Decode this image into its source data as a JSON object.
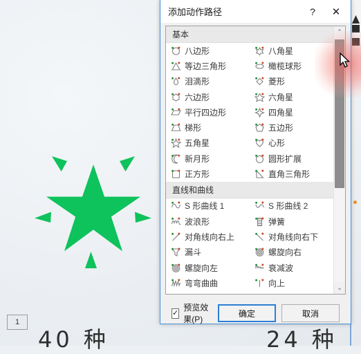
{
  "background": {
    "slide_number": "1",
    "label_left": "40 种",
    "label_right": "24 种",
    "star_color": "#0ec25c"
  },
  "dialog": {
    "title": "添加动作路径",
    "help_button": "?",
    "close_button": "✕",
    "accent_color": "#2a7fd4",
    "sections": [
      {
        "header": "基本",
        "items": [
          {
            "label": "八边形",
            "icon": "octagon-path-icon"
          },
          {
            "label": "八角星",
            "icon": "eight-point-star-path-icon"
          },
          {
            "label": "等边三角形",
            "icon": "equilateral-triangle-path-icon"
          },
          {
            "label": "橄榄球形",
            "icon": "football-path-icon"
          },
          {
            "label": "泪滴形",
            "icon": "teardrop-path-icon"
          },
          {
            "label": "菱形",
            "icon": "diamond-path-icon"
          },
          {
            "label": "六边形",
            "icon": "hexagon-path-icon"
          },
          {
            "label": "六角星",
            "icon": "six-point-star-path-icon"
          },
          {
            "label": "平行四边形",
            "icon": "parallelogram-path-icon"
          },
          {
            "label": "四角星",
            "icon": "four-point-star-path-icon"
          },
          {
            "label": "梯形",
            "icon": "trapezoid-path-icon"
          },
          {
            "label": "五边形",
            "icon": "pentagon-path-icon"
          },
          {
            "label": "五角星",
            "icon": "five-point-star-path-icon"
          },
          {
            "label": "心形",
            "icon": "heart-path-icon"
          },
          {
            "label": "新月形",
            "icon": "crescent-moon-path-icon"
          },
          {
            "label": "圆形扩展",
            "icon": "circle-expand-path-icon"
          },
          {
            "label": "正方形",
            "icon": "square-path-icon"
          },
          {
            "label": "直角三角形",
            "icon": "right-triangle-path-icon"
          }
        ]
      },
      {
        "header": "直线和曲线",
        "items": [
          {
            "label": "S 形曲线 1",
            "icon": "s-curve-1-path-icon"
          },
          {
            "label": "S 形曲线 2",
            "icon": "s-curve-2-path-icon"
          },
          {
            "label": "波浪形",
            "icon": "wave-path-icon"
          },
          {
            "label": "弹簧",
            "icon": "spring-path-icon"
          },
          {
            "label": "对角线向右上",
            "icon": "diagonal-up-right-path-icon"
          },
          {
            "label": "对角线向右下",
            "icon": "diagonal-down-right-path-icon"
          },
          {
            "label": "漏斗",
            "icon": "funnel-path-icon"
          },
          {
            "label": "螺旋向右",
            "icon": "spiral-right-path-icon"
          },
          {
            "label": "螺旋向左",
            "icon": "spiral-left-path-icon"
          },
          {
            "label": "衰减波",
            "icon": "decaying-wave-path-icon"
          },
          {
            "label": "弯弯曲曲",
            "icon": "zigzag-path-icon"
          },
          {
            "label": "向上",
            "icon": "up-path-icon"
          }
        ]
      }
    ],
    "scrollbar": {
      "up_arrow": "⌃",
      "down_arrow": "⌄"
    },
    "footer": {
      "preview_label": "预览效果(P)",
      "preview_checked": "✓",
      "ok_label": "确定",
      "cancel_label": "取消"
    }
  }
}
